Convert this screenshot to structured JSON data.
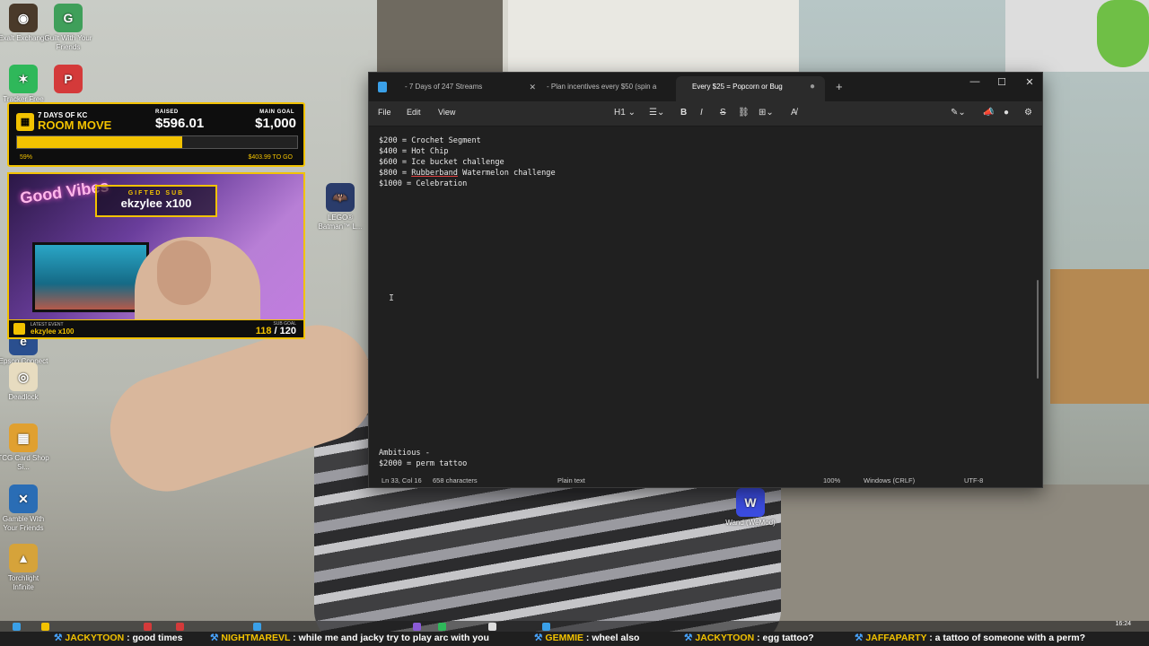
{
  "desktop_icons": [
    {
      "label": "Exalt Exchange",
      "x_name": "exalt-exchange",
      "color": "#4a3a2a",
      "glyph": "◉"
    },
    {
      "label": "Guilt With Your Friends",
      "x_name": "guilt-with-friends",
      "color": "#3f9f5a",
      "glyph": "G"
    },
    {
      "label": "Tracker Free",
      "x_name": "tracker-free",
      "color": "#2fb85a",
      "glyph": "✶"
    },
    {
      "label": "",
      "x_name": "pp-app",
      "color": "#d43a3a",
      "glyph": "P"
    },
    {
      "label": "LEGO® Batman™ L...",
      "x_name": "lego-batman",
      "color": "#2a3c6b",
      "glyph": "🦇"
    },
    {
      "label": "Epson Connect",
      "x_name": "epson-connect",
      "color": "#2a4f8f",
      "glyph": "e"
    },
    {
      "label": "Deadlock",
      "x_name": "deadlock",
      "color": "#e7dcc0",
      "glyph": "◎"
    },
    {
      "label": "TCG Card Shop Si...",
      "x_name": "tcg-card-shop",
      "color": "#e0a030",
      "glyph": "▦"
    },
    {
      "label": "Gamble With Your Friends",
      "x_name": "gamble-with-friends",
      "color": "#2a6db5",
      "glyph": "✕"
    },
    {
      "label": "Torchlight Infinite",
      "x_name": "torchlight-infinite",
      "color": "#d6a33a",
      "glyph": "▲"
    },
    {
      "label": "Wand (WeMod)",
      "x_name": "wand-wemod",
      "color": "#3b4ce0",
      "glyph": "W"
    }
  ],
  "goal": {
    "subtitle": "7 DAYS OF KC",
    "title": "ROOM MOVE",
    "raised_label": "RAISED",
    "raised_value": "$596.01",
    "goal_label": "MAIN GOAL",
    "goal_value": "$1,000",
    "percent_text": "59%",
    "percent_value": 0.59,
    "to_go": "$403.99 TO GO"
  },
  "cam": {
    "neon_sign": "Good Vibes",
    "gift_label": "GIFTED SUB",
    "gift_name": "ekzylee x100",
    "latest_label": "LATEST EVENT",
    "latest_value": "ekzylee x100",
    "subgoal_label": "SUB GOAL",
    "subgoal_current": "118",
    "subgoal_total": "/ 120"
  },
  "notepad": {
    "tabs": [
      {
        "label": "- 7 Days of 247 Streams",
        "active": false
      },
      {
        "label": "- Plan incentives every $50 (spin a",
        "active": false
      },
      {
        "label": "Every $25 = Popcorn or Bug",
        "active": true
      }
    ],
    "new_tab": "+",
    "window_controls": {
      "minimize": "—",
      "maximize": "☐",
      "close": "✕"
    },
    "menus": {
      "file": "File",
      "edit": "Edit",
      "view": "View"
    },
    "toolbar": {
      "heading": "H1",
      "bold": "B",
      "italic": "I",
      "strike": "S"
    },
    "lines": [
      {
        "text": "$200 = Crochet Segment"
      },
      {
        "text": "$400 = Hot Chip"
      },
      {
        "text": "$600 = Ice bucket challenge"
      },
      {
        "prefix": "$800 = ",
        "error": "Rubberband",
        "suffix": " Watermelon challenge"
      },
      {
        "text": "$1000 = Celebration"
      }
    ],
    "bottom_lines": [
      {
        "text": "Ambitious -"
      },
      {
        "text": "$2000 = perm tattoo"
      }
    ],
    "status": {
      "position": "Ln 33, Col 16",
      "chars": "658 characters",
      "format": "Plain text",
      "zoom": "100%",
      "line_ending": "Windows (CRLF)",
      "encoding": "UTF-8"
    }
  },
  "taskbar": {
    "time": "16:24"
  },
  "ticker": [
    {
      "user": "JACKYTOON",
      "msg": ": good times"
    },
    {
      "user": "NIGHTMAREVL",
      "msg": ": while me and jacky try to play arc with you"
    },
    {
      "user": "GEMMIE",
      "msg": ": wheel also"
    },
    {
      "user": "JACKYTOON",
      "msg": ": egg tattoo?"
    },
    {
      "user": "JAFFAPARTY",
      "msg": ": a tattoo of someone with a perm?"
    }
  ]
}
